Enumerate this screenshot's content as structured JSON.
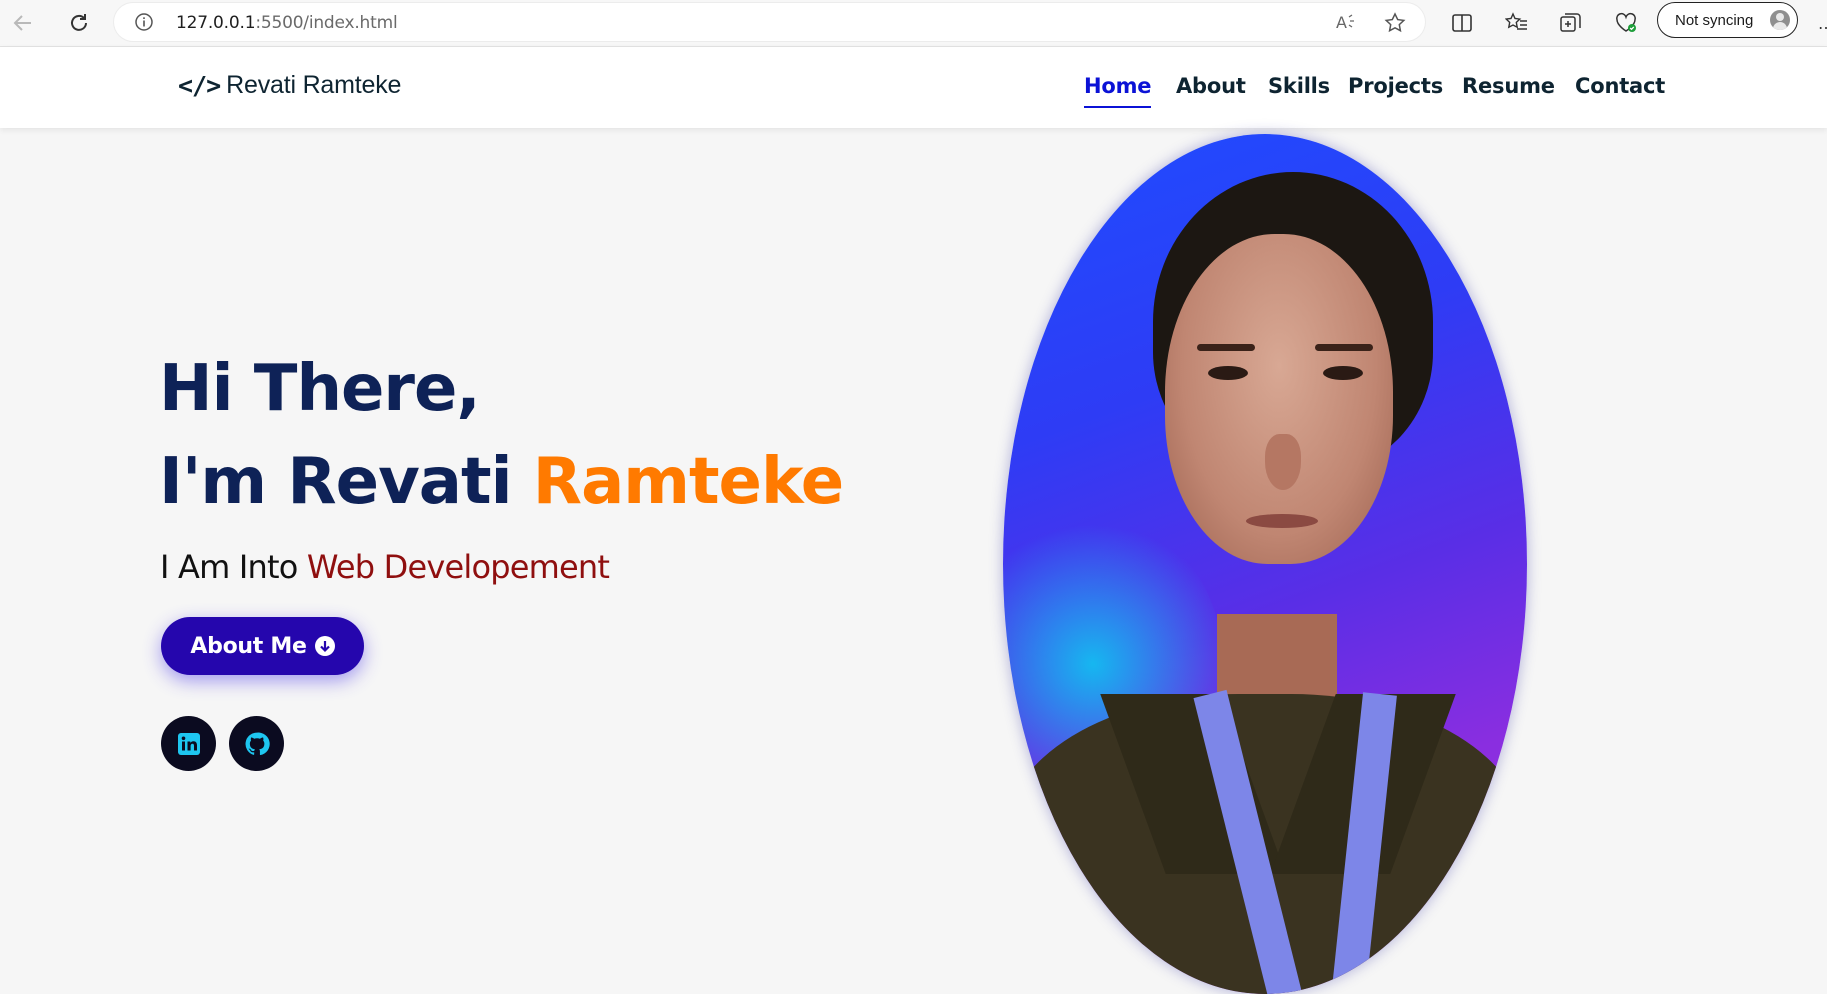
{
  "browser": {
    "url_host": "127.0.0.1",
    "url_rest": ":5500/index.html",
    "profile_label": "Not syncing"
  },
  "site": {
    "brand_icon": "</>",
    "brand_name": "Revati Ramteke",
    "nav": [
      {
        "label": "Home",
        "active": true
      },
      {
        "label": "About",
        "active": false
      },
      {
        "label": "Skills",
        "active": false
      },
      {
        "label": "Projects",
        "active": false
      },
      {
        "label": "Resume",
        "active": false
      },
      {
        "label": "Contact",
        "active": false
      }
    ]
  },
  "hero": {
    "greeting": "Hi There,",
    "intro_prefix": "I'm Revati ",
    "intro_accent": "Ramteke",
    "tagline_prefix": "I Am Into ",
    "tagline_typed": "Web Developement",
    "about_button": "About Me",
    "social": [
      "linkedin-icon",
      "github-icon"
    ]
  },
  "colors": {
    "nav_active": "#0b12d6",
    "title": "#0e2257",
    "accent": "#ff7a00",
    "typed": "#8f0f0f",
    "button": "#2506ad",
    "social_icon": "#1ec6f0"
  }
}
